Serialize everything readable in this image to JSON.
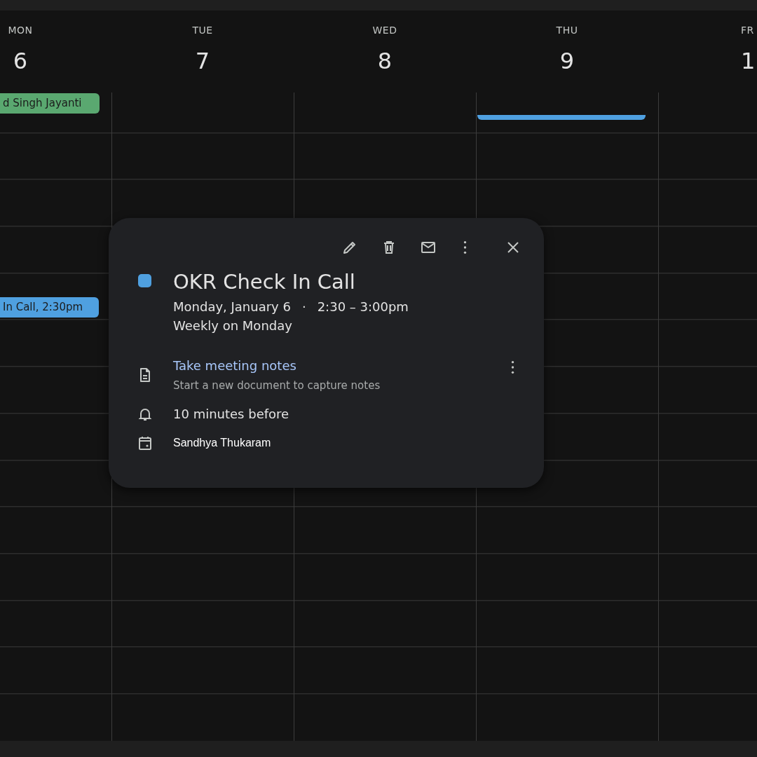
{
  "days": [
    {
      "name": "MON",
      "date": "6",
      "all_day_events": [
        {
          "title": "d Singh Jayanti",
          "color": "#5aa870"
        }
      ],
      "events": [
        {
          "title": "In Call,",
          "time": "2:30pm",
          "color": "#4fa0e0"
        }
      ]
    },
    {
      "name": "TUE",
      "date": "7"
    },
    {
      "name": "WED",
      "date": "8"
    },
    {
      "name": "THU",
      "date": "9",
      "events": [
        {
          "color": "#4fa0e0"
        }
      ]
    },
    {
      "name": "FR",
      "date": "1"
    }
  ],
  "popup": {
    "color": "#4fa0e0",
    "title": "OKR Check In Call",
    "date": "Monday, January 6",
    "separator": "·",
    "time": "2:30 – 3:00pm",
    "recurrence": "Weekly on Monday",
    "notes": {
      "link": "Take meeting notes",
      "description": "Start a new document to capture notes"
    },
    "reminder": "10 minutes before",
    "calendar": "Sandhya Thukaram"
  }
}
